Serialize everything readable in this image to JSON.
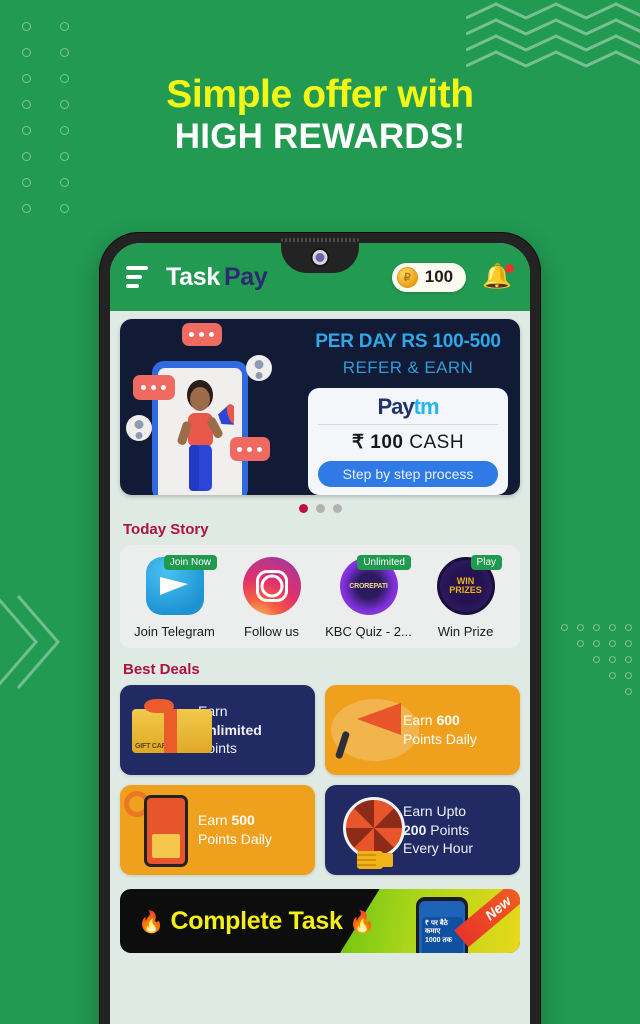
{
  "promo": {
    "headline_line1": "Simple offer with",
    "headline_line2": "HIGH REWARDS!",
    "background_color": "#229a52",
    "headline_accent_color": "#f2f716"
  },
  "app": {
    "header": {
      "menu_icon": "hamburger-icon",
      "brand_first": "Task",
      "brand_second": "Pay",
      "coin_icon": "coin-icon",
      "coin_symbol": "₽",
      "points_value": "100",
      "bell_icon": "bell-icon",
      "notification_dot": true
    },
    "hero_banner": {
      "title": "PER DAY RS 100-500",
      "subtitle": "REFER & EARN",
      "paytm_logo_a": "Pay",
      "paytm_logo_b": "tm",
      "cash_amount": "₹ 100",
      "cash_label": "CASH",
      "cta": "Step by step process",
      "dots": [
        "active",
        "inactive",
        "inactive"
      ],
      "dot_active_color": "#bf0f4a"
    },
    "today_story": {
      "title": "Today Story",
      "items": [
        {
          "label": "Join Telegram",
          "badge": "Join Now",
          "icon": "telegram-icon"
        },
        {
          "label": "Follow us",
          "badge": "",
          "icon": "instagram-icon"
        },
        {
          "label": "KBC Quiz - 2...",
          "badge": "Unlimited",
          "icon": "kbc-crorepati-icon",
          "icon_text": "CROREPATI"
        },
        {
          "label": "Win Prize",
          "badge": "Play",
          "icon": "win-prizes-icon",
          "icon_text": "WIN PRIZES"
        }
      ]
    },
    "best_deals": {
      "title": "Best Deals",
      "items": [
        {
          "line1": "Earn",
          "line2": "Unlimited",
          "line3": "Points",
          "theme": "navy",
          "art": "gift-card-icon",
          "art_label": "GIFT CARD"
        },
        {
          "line1": "Earn ",
          "line2": "600",
          "line3": "Points Daily",
          "theme": "amber",
          "art": "megaphone-icon",
          "art_label": ""
        },
        {
          "line1": "Earn ",
          "line2": "500",
          "line3": "Points Daily",
          "theme": "amber",
          "art": "mobile-icon",
          "art_label": ""
        },
        {
          "line1": "Earn Upto",
          "line2": "200",
          "line3": "Points",
          "line4": "Every Hour",
          "theme": "navy",
          "art": "spin-wheel-icon",
          "art_label": ""
        }
      ]
    },
    "complete_task": {
      "title": "Complete Task",
      "fire_icon": "fire-icon",
      "ribbon": "New",
      "phone_text_line1": "पर बैठे कमाए",
      "phone_text_line2": "1000 तक",
      "phone_currency": "₹"
    }
  }
}
